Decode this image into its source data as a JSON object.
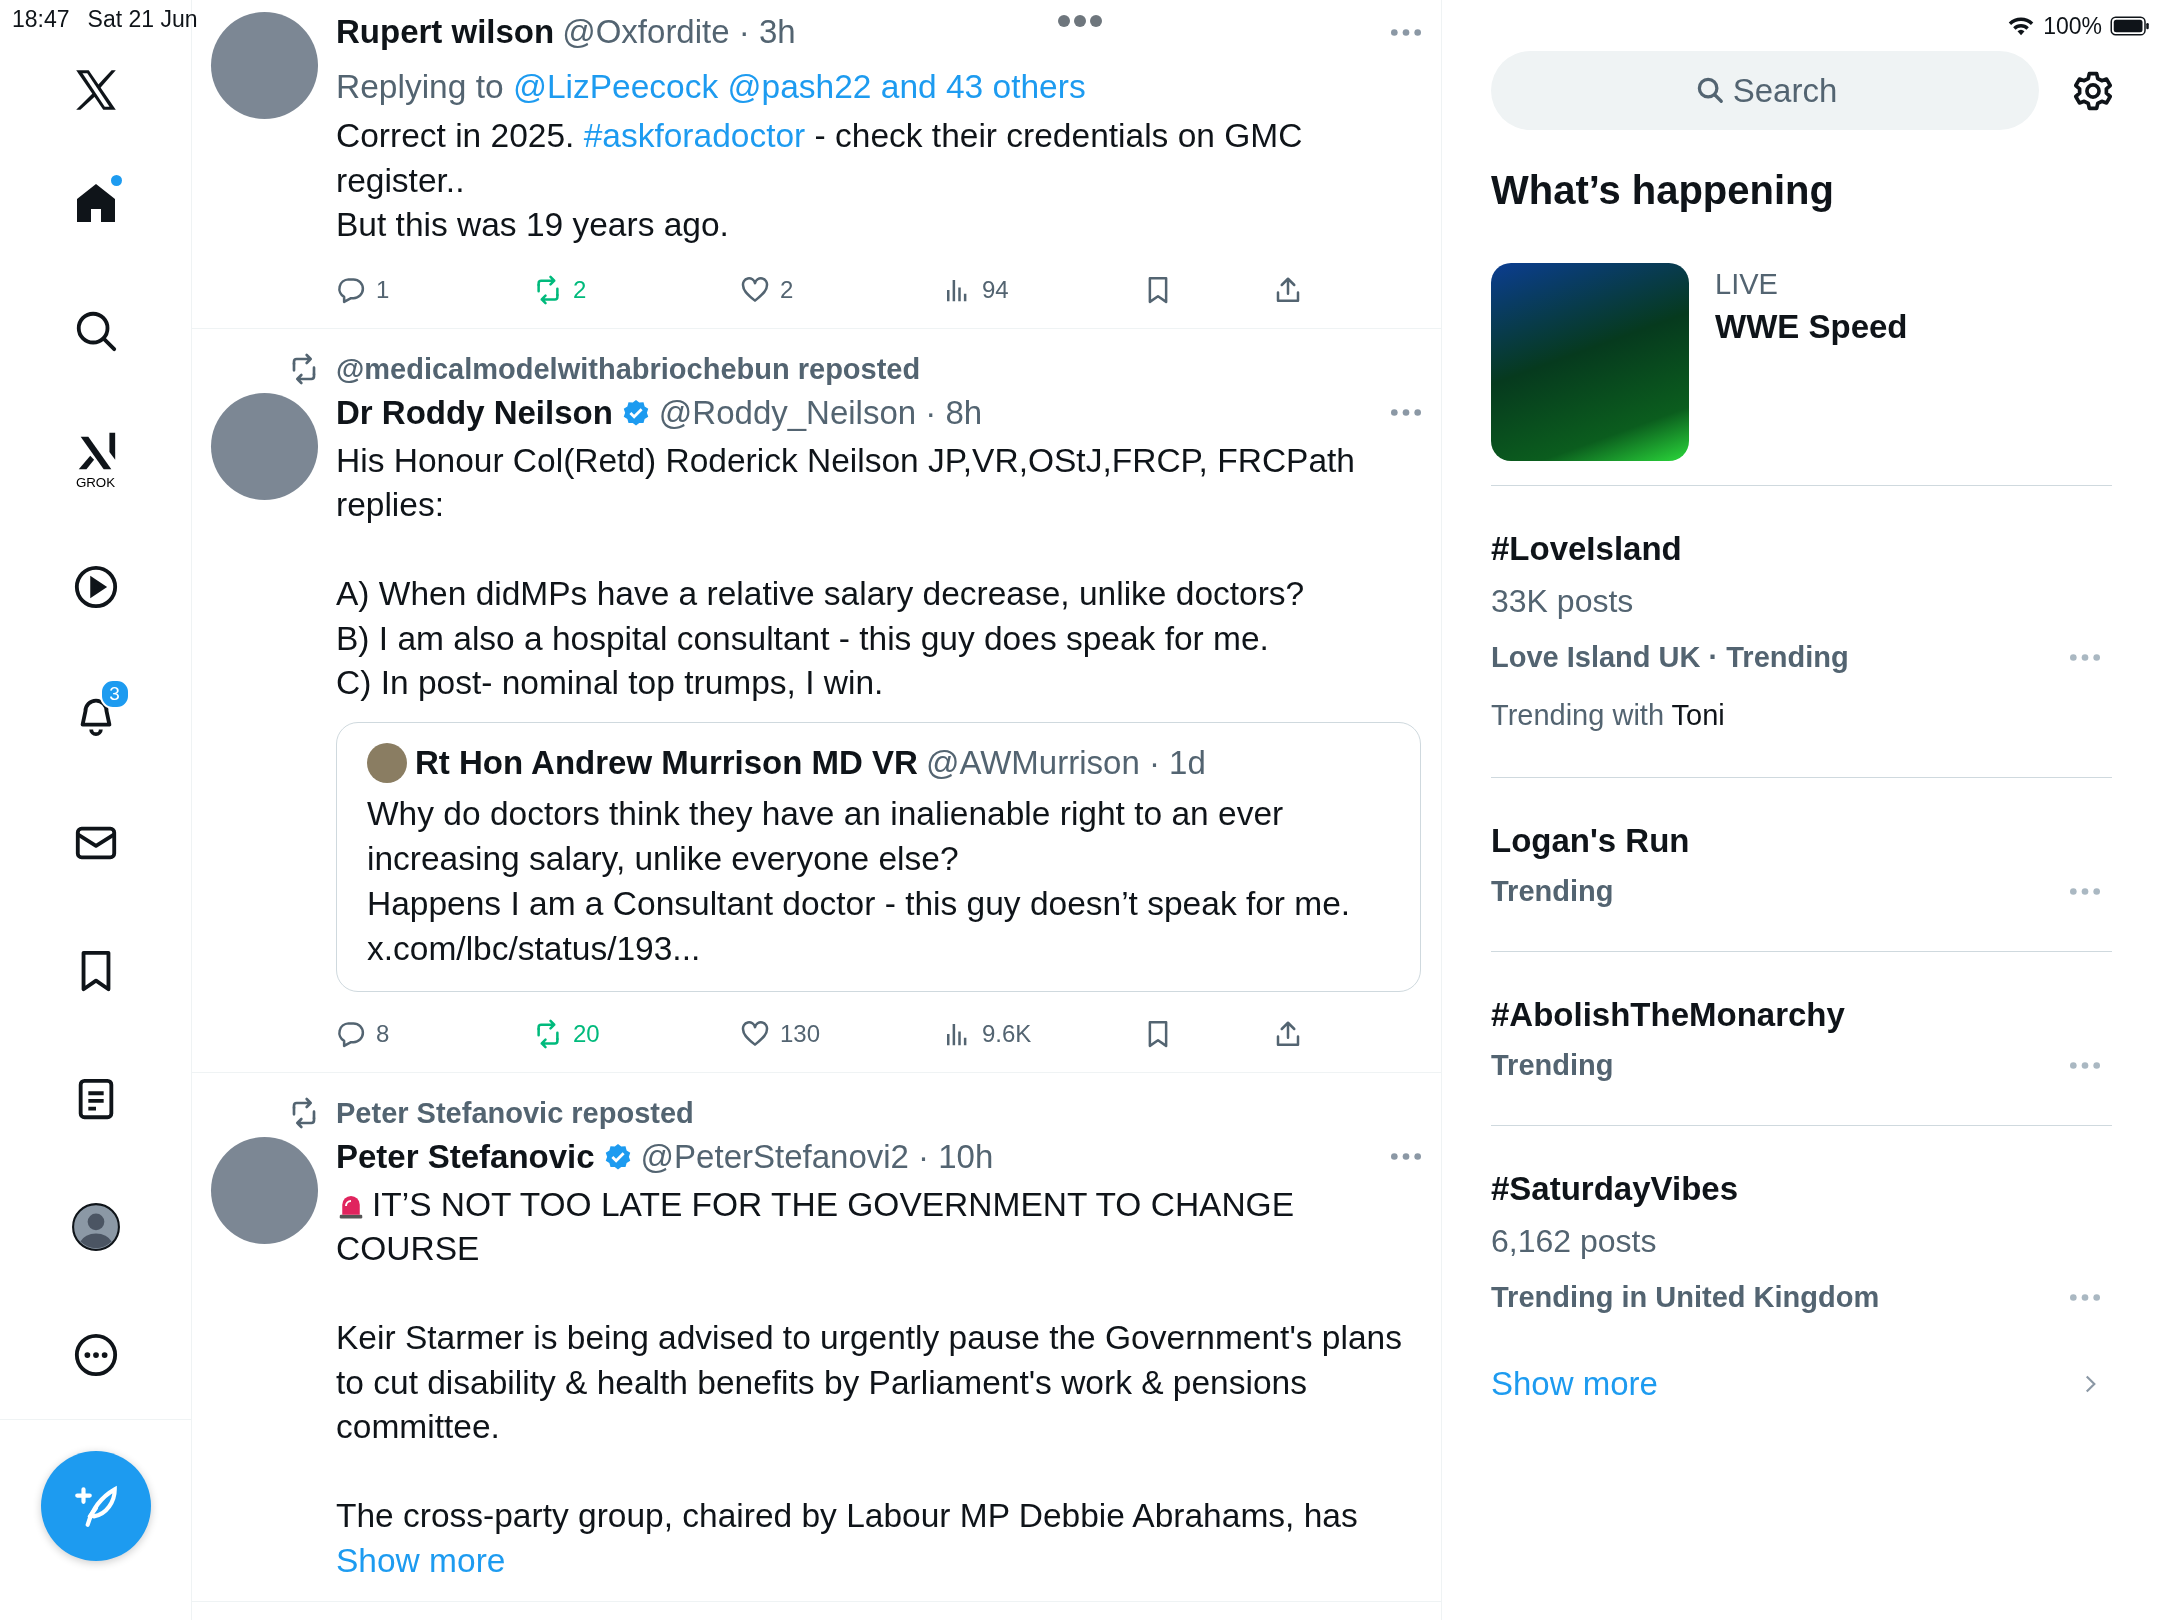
{
  "status_bar": {
    "time": "18:47",
    "date": "Sat 21 Jun",
    "battery": "100%"
  },
  "sidebar": {
    "items": [
      {
        "kind": "home",
        "selected": true,
        "unread": true
      },
      {
        "kind": "search",
        "selected": false
      },
      {
        "kind": "grok",
        "label": "GROK",
        "selected": false
      },
      {
        "kind": "video",
        "selected": false
      },
      {
        "kind": "notifications",
        "badge": "3",
        "selected": false
      },
      {
        "kind": "messages",
        "selected": false
      },
      {
        "kind": "bookmarks",
        "selected": false
      },
      {
        "kind": "lists",
        "selected": false
      },
      {
        "kind": "profile",
        "selected": false
      },
      {
        "kind": "more",
        "selected": false
      }
    ]
  },
  "timeline": [
    {
      "name": "Rupert wilson",
      "verified": false,
      "meta": "@Oxfordite · 3h",
      "replying_to": {
        "label": "Replying to",
        "names": "@LizPeecock @pash22 and 43 others"
      },
      "body": [
        {
          "kind": "text",
          "text": "Correct in 2025. "
        },
        {
          "kind": "link",
          "text": "#askforadoctor"
        },
        {
          "kind": "text",
          "text": " - check their credentials on GMC register..\nBut this was 19 years ago."
        }
      ],
      "actions": {
        "replies": "1",
        "reposts": "2",
        "reposted": true,
        "likes": "2",
        "liked": false,
        "views": "94"
      }
    },
    {
      "reposted_by": "@medicalmodelwithabriochebun reposted",
      "name": "Dr Roddy Neilson",
      "verified": true,
      "meta": "@Roddy_Neilson · 8h",
      "body": [
        {
          "kind": "text",
          "text": "His Honour Col(Retd) Roderick Neilson JP,VR,OStJ,FRCP, FRCPath replies:\n\nA) When didMPs have a relative salary decrease, unlike doctors?\nB) I am also a hospital consultant - this guy does speak for me.\nC) In post- nominal top trumps, I win."
        }
      ],
      "quote": {
        "name": "Rt Hon Andrew Murrison MD VR",
        "meta": "@AWMurrison · 1d",
        "text": "Why do doctors think they have an inalienable right to an ever increasing salary, unlike everyone else?\nHappens I am a Consultant doctor - this guy doesn’t speak for me.\nx.com/lbc/status/193..."
      },
      "actions": {
        "replies": "8",
        "reposts": "20",
        "reposted": true,
        "likes": "130",
        "liked": false,
        "views": "9.6K"
      }
    },
    {
      "reposted_by": "Peter Stefanovic reposted",
      "name": "Peter Stefanovic",
      "verified": true,
      "meta": "@PeterStefanovi2 · 10h",
      "body": [
        {
          "kind": "siren"
        },
        {
          "kind": "text",
          "text": "IT’S NOT TOO LATE FOR THE GOVERNMENT TO CHANGE COURSE\n\nKeir Starmer is being advised to urgently pause the Government's plans to cut disability & health benefits by Parliament's work & pensions committee.\n\nThe cross-party group, chaired by Labour MP Debbie Abrahams, has "
        },
        {
          "kind": "link",
          "text": "Show more"
        }
      ]
    }
  ],
  "right": {
    "search": {
      "placeholder": "Search"
    },
    "heading": "What’s happening",
    "trends": [
      {
        "kind": "live",
        "label": "LIVE",
        "title": "WWE Speed"
      },
      {
        "kind": "trend",
        "title": "#LoveIsland",
        "posts": "33K posts",
        "context": "Love Island UK · Trending",
        "trending_with": {
          "label": "Trending with",
          "name": "Toni"
        }
      },
      {
        "kind": "trend",
        "title": "Logan's Run",
        "context": "Trending"
      },
      {
        "kind": "trend",
        "title": "#AbolishTheMonarchy",
        "context": "Trending"
      },
      {
        "kind": "trend",
        "title": "#SaturdayVibes",
        "posts": "6,162 posts",
        "context": "Trending in United Kingdom"
      }
    ],
    "show_more": "Show more"
  }
}
